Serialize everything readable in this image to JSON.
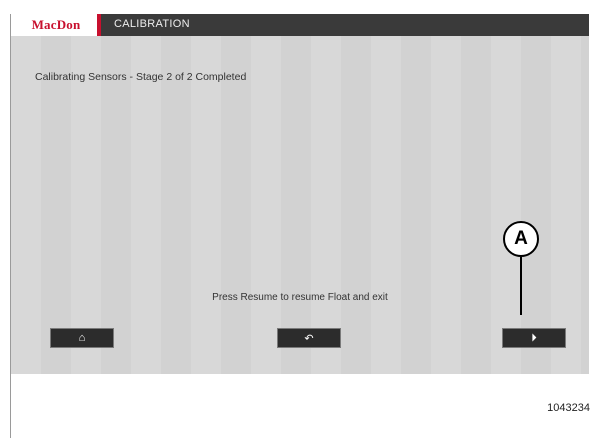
{
  "header": {
    "brand": "MacDon",
    "title": "CALIBRATION",
    "brand_color": "#c8102e",
    "bar_color": "#3a3a3a"
  },
  "main": {
    "status": "Calibrating Sensors - Stage 2 of 2 Completed",
    "prompt": "Press Resume to resume Float and exit"
  },
  "softkeys": {
    "home_icon": "⌂",
    "back_icon": "↶",
    "resume_icon": "⏵"
  },
  "callout": {
    "label": "A"
  },
  "figure": {
    "id": "1043234"
  }
}
